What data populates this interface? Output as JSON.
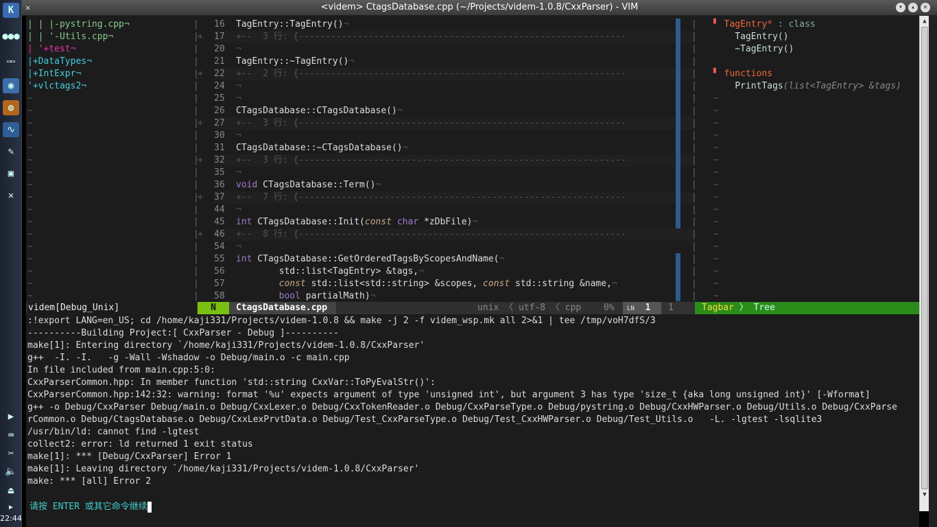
{
  "window": {
    "title": "<videm> CtagsDatabase.cpp (~/Projects/videm-1.0.8/CxxParser) - VIM",
    "clock": "22:44"
  },
  "nerd": {
    "lines": [
      "| | |-pystring.cpp¬",
      "| | '-Utils.cpp¬",
      "| '+test¬",
      "|+DataTypes¬",
      "|+IntExpr¬",
      "'+vlctags2¬"
    ],
    "tilde": "~"
  },
  "code": {
    "lines": [
      {
        "n": "16",
        "t": "TagEntry::TagEntry()¬"
      },
      {
        "n": "17",
        "t": "+--  3 行: {-------------------------------------------------------------",
        "fold": true
      },
      {
        "n": "20",
        "t": "¬"
      },
      {
        "n": "21",
        "t": "TagEntry::~TagEntry()¬"
      },
      {
        "n": "22",
        "t": "+--  2 行: {-------------------------------------------------------------",
        "fold": true
      },
      {
        "n": "24",
        "t": "¬"
      },
      {
        "n": "25",
        "t": "¬"
      },
      {
        "n": "26",
        "t": "CTagsDatabase::CTagsDatabase()¬"
      },
      {
        "n": "27",
        "t": "+--  3 行: {-------------------------------------------------------------",
        "fold": true
      },
      {
        "n": "30",
        "t": "¬"
      },
      {
        "n": "31",
        "t": "CTagsDatabase::~CTagsDatabase()¬"
      },
      {
        "n": "32",
        "t": "+--  3 行: {-------------------------------------------------------------",
        "fold": true
      },
      {
        "n": "35",
        "t": "¬"
      },
      {
        "n": "36",
        "t": "void CTagsDatabase::Term()¬"
      },
      {
        "n": "37",
        "t": "+--  7 行: {-------------------------------------------------------------",
        "fold": true
      },
      {
        "n": "44",
        "t": "¬"
      },
      {
        "n": "45",
        "t": "int CTagsDatabase::Init(const char *zDbFile)¬"
      },
      {
        "n": "46",
        "t": "+--  8 行: {-------------------------------------------------------------",
        "fold": true
      },
      {
        "n": "54",
        "t": "¬"
      },
      {
        "n": "55",
        "t": "int CTagsDatabase::GetOrderedTagsByScopesAndName(¬"
      },
      {
        "n": "56",
        "t": "        std::list<TagEntry> &tags,¬"
      },
      {
        "n": "57",
        "t": "        const std::list<std::string> &scopes, const std::string &name,¬"
      },
      {
        "n": "58",
        "t": "        bool partialMath)¬"
      }
    ]
  },
  "tagbar": {
    "class_name": "TagEntry",
    "class_mod": "*",
    "class_kind": " : class",
    "ctor": "TagEntry()",
    "dtor": "~TagEntry()",
    "functions_label": "functions",
    "fn_name": "PrintTags",
    "fn_sig": "(list<TagEntry> &tags)"
  },
  "status": {
    "left": "videm[Debug_Unix]",
    "mode": "N",
    "file": "CtagsDatabase.cpp",
    "format": "unix",
    "encoding": "utf-8",
    "filetype": "cpp",
    "percent": "0%",
    "ln_symbol": "LN",
    "line": "1",
    "col": "1",
    "tagbar": "Tagbar",
    "tagbar_mode": "Tree"
  },
  "output": [
    ":!export LANG=en_US; cd /home/kaji331/Projects/videm-1.0.8 && make -j 2 -f videm_wsp.mk all 2>&1 | tee /tmp/voH7dfS/3",
    "----------Building Project:[ CxxParser - Debug ]----------",
    "make[1]: Entering directory `/home/kaji331/Projects/videm-1.0.8/CxxParser'",
    "g++  -I. -I.   -g -Wall -Wshadow -o Debug/main.o -c main.cpp",
    "In file included from main.cpp:5:0:",
    "CxxParserCommon.hpp: In member function 'std::string CxxVar::ToPyEvalStr()':",
    "CxxParserCommon.hpp:142:32: warning: format '%u' expects argument of type 'unsigned int', but argument 3 has type 'size_t {aka long unsigned int}' [-Wformat]",
    "g++ -o Debug/CxxParser Debug/main.o Debug/CxxLexer.o Debug/CxxTokenReader.o Debug/CxxParseType.o Debug/pystring.o Debug/CxxHWParser.o Debug/Utils.o Debug/CxxParse",
    "rCommon.o Debug/CtagsDatabase.o Debug/CxxLexPrvtData.o Debug/Test_CxxParseType.o Debug/Test_CxxHWParser.o Debug/Test_Utils.o   -L. -lgtest -lsqlite3",
    "/usr/bin/ld: cannot find -lgtest",
    "collect2: error: ld returned 1 exit status",
    "make[1]: *** [Debug/CxxParser] Error 1",
    "make[1]: Leaving directory `/home/kaji331/Projects/videm-1.0.8/CxxParser'",
    "make: *** [all] Error 2"
  ],
  "prompt": "请按 ENTER 或其它命令继续"
}
